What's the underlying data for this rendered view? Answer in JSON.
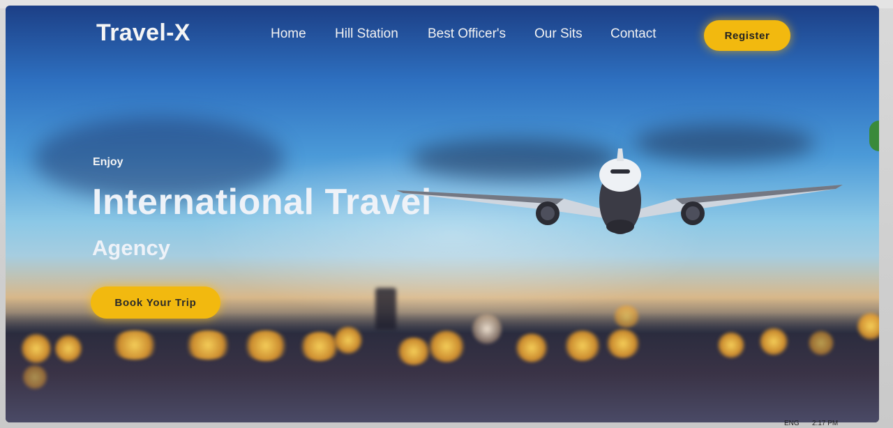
{
  "brand": {
    "logo": "Travel-X"
  },
  "nav": {
    "items": [
      {
        "label": "Home"
      },
      {
        "label": "Hill Station"
      },
      {
        "label": "Best Officer's"
      },
      {
        "label": "Our Sits"
      },
      {
        "label": "Contact"
      }
    ],
    "register_label": "Register"
  },
  "hero": {
    "eyebrow": "Enjoy",
    "title": "International Travel",
    "subtitle": "Agency",
    "cta_label": "Book Your Trip"
  },
  "taskbar": {
    "language": "ENG",
    "time": "2:17 PM"
  },
  "colors": {
    "accent": "#f2b90f",
    "sky_top": "#1c3f86",
    "sky_mid": "#4b9ad8",
    "text_light": "#eef2f8"
  },
  "icons": {
    "airplane": "airplane-illustration"
  }
}
